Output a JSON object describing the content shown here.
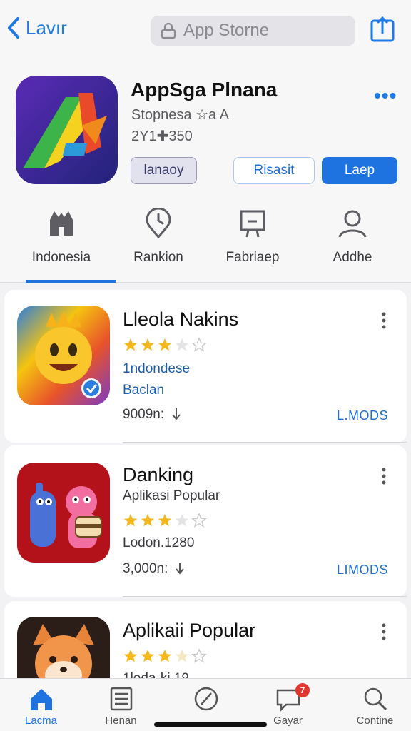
{
  "topbar": {
    "back_label": "Lavır",
    "search_placeholder": "App Storne"
  },
  "app": {
    "title": "AppSga Plnana",
    "subtitle": "Stopnesa ☆a A",
    "meta": "2Y1✚350",
    "buttons": [
      "lanaoy",
      "Risasit",
      "Laep"
    ],
    "accent": "#1e73e0"
  },
  "tabs": [
    {
      "label": "Indonesia",
      "icon": "store-icon"
    },
    {
      "label": "Rankion",
      "icon": "location-clock-icon"
    },
    {
      "label": "Fabriaep",
      "icon": "board-icon"
    },
    {
      "label": "Addhe",
      "icon": "person-icon"
    }
  ],
  "list": [
    {
      "name": "Lleola Nakins",
      "rating": 3,
      "line1": "1ndondese",
      "line2": "Baclan",
      "downloads": "9009n:",
      "action": "L.MODS"
    },
    {
      "name": "Danking",
      "sub": "Aplikasi Popular",
      "rating": 3,
      "line1": "Lodon.1280",
      "downloads": "3,000n:",
      "action": "LIMODS"
    },
    {
      "name": "Aplikaii Popular",
      "rating": 3,
      "line1": "1loda-ki 19"
    }
  ],
  "bottom_nav": [
    {
      "label": "Lacma",
      "icon": "home-icon"
    },
    {
      "label": "Henan",
      "icon": "list-icon"
    },
    {
      "label": "",
      "icon": "compass-icon"
    },
    {
      "label": "Gayar",
      "icon": "chat-icon",
      "badge": "7"
    },
    {
      "label": "Contine",
      "icon": "search-icon"
    }
  ]
}
